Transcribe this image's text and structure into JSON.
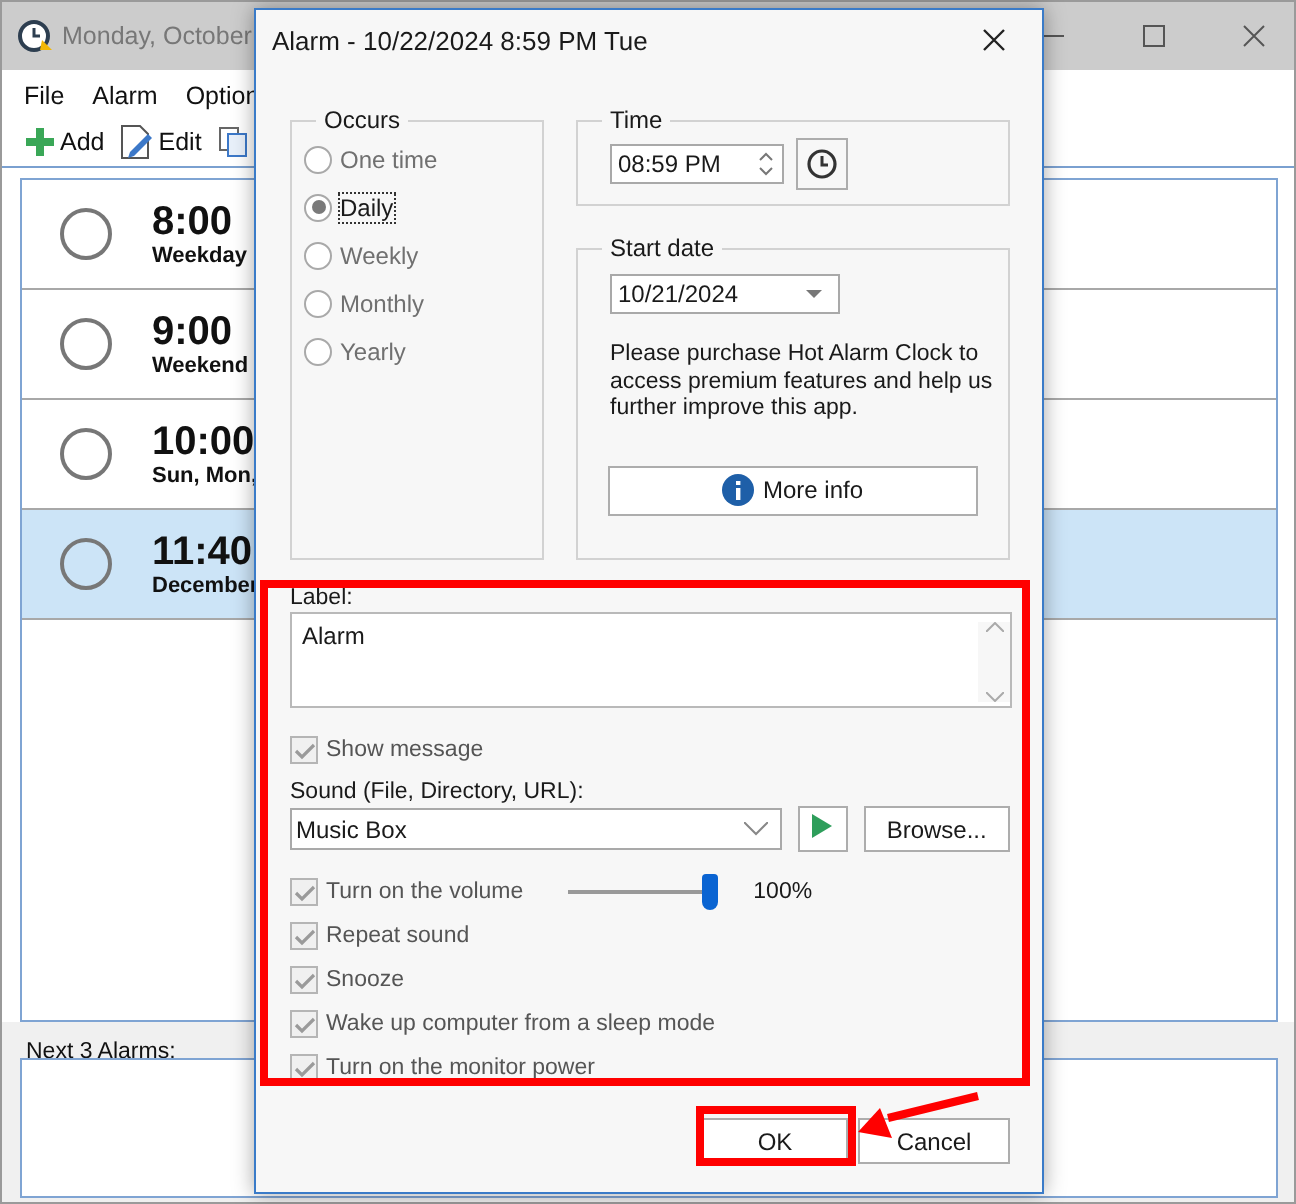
{
  "main_window": {
    "title": "Monday, October",
    "menu": [
      "File",
      "Alarm",
      "Option"
    ],
    "toolbar": [
      {
        "kind": "add",
        "label": "Add"
      },
      {
        "kind": "edit",
        "label": "Edit"
      },
      {
        "kind": "copy"
      }
    ],
    "alarms": [
      {
        "time": "8:00",
        "detail": "Weekday",
        "selected": false
      },
      {
        "time": "9:00",
        "detail": "Weekend",
        "selected": false
      },
      {
        "time": "10:00",
        "detail": "Sun, Mon,",
        "selected": false
      },
      {
        "time": "11:40",
        "detail": "December",
        "selected": true
      }
    ],
    "next_alarms_label": "Next 3 Alarms:"
  },
  "dialog": {
    "title": "Alarm - 10/22/2024 8:59 PM Tue",
    "occurs": {
      "label": "Occurs",
      "options": [
        {
          "label": "One time",
          "selected": false
        },
        {
          "label": "Daily",
          "selected": true
        },
        {
          "label": "Weekly",
          "selected": false
        },
        {
          "label": "Monthly",
          "selected": false
        },
        {
          "label": "Yearly",
          "selected": false
        }
      ]
    },
    "time": {
      "label": "Time",
      "value": "08:59 PM"
    },
    "start_date": {
      "label": "Start date",
      "value": "10/21/2024"
    },
    "promo": "Please purchase Hot Alarm Clock to access premium features and help us further improve this app.",
    "more_info_button": "More info",
    "label_field": {
      "label": "Label:",
      "value": "Alarm"
    },
    "show_message": {
      "label": "Show message",
      "checked": true
    },
    "sound": {
      "label": "Sound (File, Directory, URL):",
      "value": "Music Box",
      "browse_button": "Browse..."
    },
    "volume": {
      "label": "Turn on the volume",
      "checked": true,
      "level": 1,
      "reading": "100%"
    },
    "options": [
      {
        "label": "Repeat sound",
        "checked": true
      },
      {
        "label": "Snooze",
        "checked": true
      },
      {
        "label": "Wake up computer from a sleep mode",
        "checked": true
      },
      {
        "label": "Turn on the monitor power",
        "checked": true
      }
    ],
    "buttons": [
      "OK",
      "Cancel"
    ]
  }
}
